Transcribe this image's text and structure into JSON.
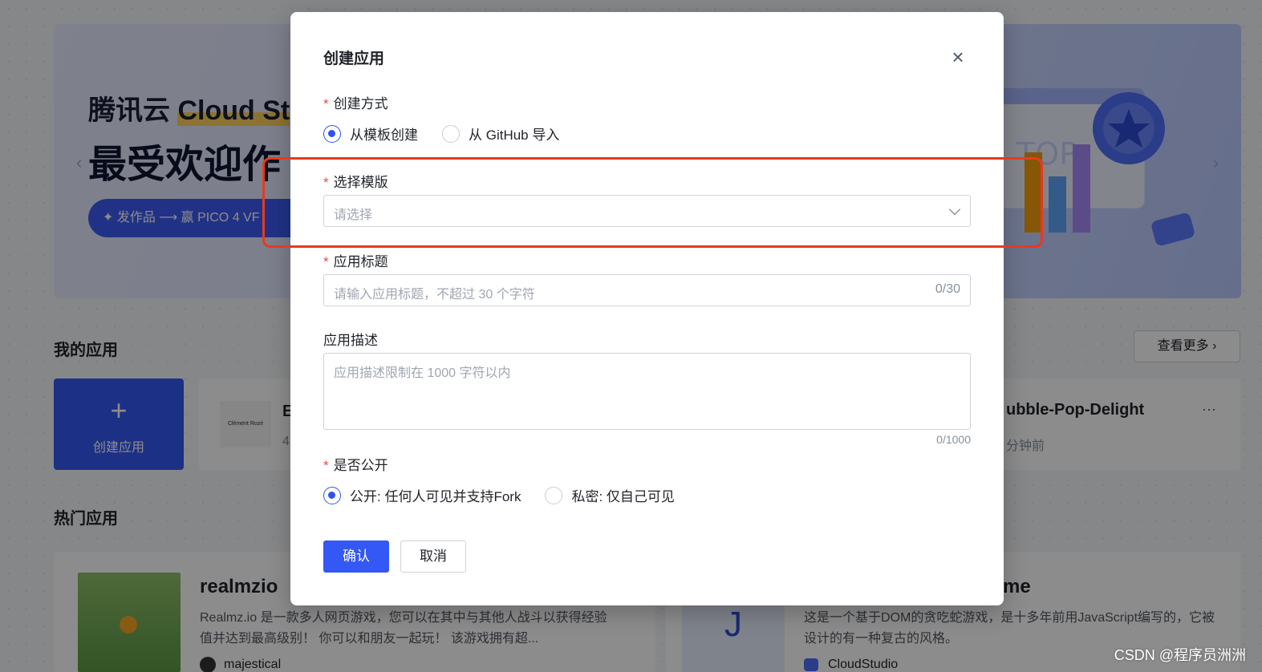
{
  "background": {
    "banner": {
      "title_prefix": "腾讯云 ",
      "title_highlight": "Cloud St",
      "subtitle": "最受欢迎作",
      "pill": "✦  发作品 ⟶ 赢 PICO 4 VF",
      "art_text": "TOP"
    },
    "my_apps": {
      "title": "我的应用",
      "more": "查看更多",
      "create_label": "创建应用",
      "create_plus": "+",
      "card_left_logo": "Clément Rozé",
      "card_left_name": "E",
      "card_left_meta": "4",
      "card_right_name": "ubble-Pop-Delight",
      "card_right_meta": "分钟前",
      "more_dots": "···"
    },
    "hot_apps": {
      "title": "热门应用",
      "left": {
        "title": "realmzio",
        "desc": "Realmz.io 是一款多人网页游戏，您可以在其中与其他人战斗以获得经验值并达到最高级别！ 你可以和朋友一起玩！ 该游戏拥有超...",
        "author": "majestical"
      },
      "right": {
        "title": "me",
        "avatar_letter": "J",
        "desc": "这是一个基于DOM的贪吃蛇游戏，是十多年前用JavaScript编写的，它被设计的有一种复古的风格。",
        "author": "CloudStudio"
      }
    }
  },
  "modal": {
    "title": "创建应用",
    "close": "×",
    "required_mark": "*",
    "create_method": {
      "label": "创建方式",
      "options": [
        {
          "label": "从模板创建",
          "checked": true
        },
        {
          "label": "从 GitHub 导入",
          "checked": false
        }
      ]
    },
    "template": {
      "label": "选择模版",
      "placeholder": "请选择"
    },
    "app_title": {
      "label": "应用标题",
      "placeholder": "请输入应用标题，不超过 30 个字符",
      "counter": "0/30"
    },
    "app_desc": {
      "label": "应用描述",
      "placeholder": "应用描述限制在 1000 字符以内",
      "counter": "0/1000"
    },
    "visibility": {
      "label": "是否公开",
      "options": [
        {
          "label": "公开: 任何人可见并支持Fork",
          "checked": true
        },
        {
          "label": "私密: 仅自己可见",
          "checked": false
        }
      ]
    },
    "confirm": "确认",
    "cancel": "取消"
  },
  "watermark": "CSDN @程序员洲洲",
  "colors": {
    "primary": "#3358f5",
    "highlight_border": "#e8391f",
    "required": "#e34d4d"
  }
}
